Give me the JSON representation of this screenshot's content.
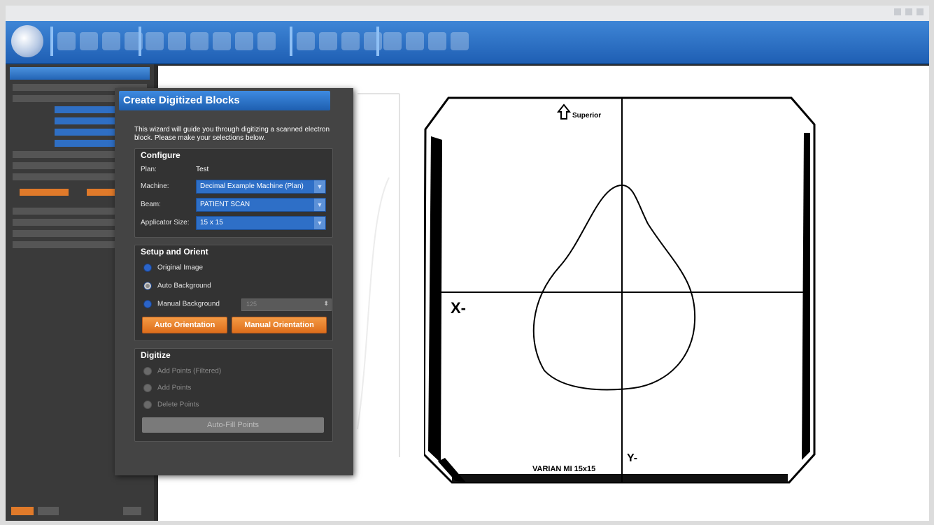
{
  "dialog": {
    "title": "Create Digitized Blocks",
    "intro": "This wizard will guide you through digitizing a scanned electron block. Please make your selections below."
  },
  "configure": {
    "heading": "Configure",
    "plan_label": "Plan:",
    "plan_value": "Test",
    "machine_label": "Machine:",
    "machine_value": "Decimal Example Machine (Plan)",
    "beam_label": "Beam:",
    "beam_value": "PATIENT SCAN",
    "applicator_label": "Applicator Size:",
    "applicator_value": "15 x 15"
  },
  "setup": {
    "heading": "Setup and Orient",
    "options": [
      "Original Image",
      "Auto Background",
      "Manual Background"
    ],
    "selected": "Auto Background",
    "manual_value": "125",
    "auto_orientation_label": "Auto Orientation",
    "manual_orientation_label": "Manual Orientation"
  },
  "digitize": {
    "heading": "Digitize",
    "options": [
      "Add Points (Filtered)",
      "Add Points",
      "Delete Points"
    ],
    "autofill_label": "Auto-Fill Points"
  },
  "scan": {
    "superior_label": "Superior",
    "x_label": "X-",
    "y_label": "Y-",
    "footer_label": "VARIAN MI 15x15"
  },
  "colors": {
    "accent_blue": "#2e6fc7",
    "orange": "#e57a25",
    "highlight": "#1f6fd0"
  }
}
